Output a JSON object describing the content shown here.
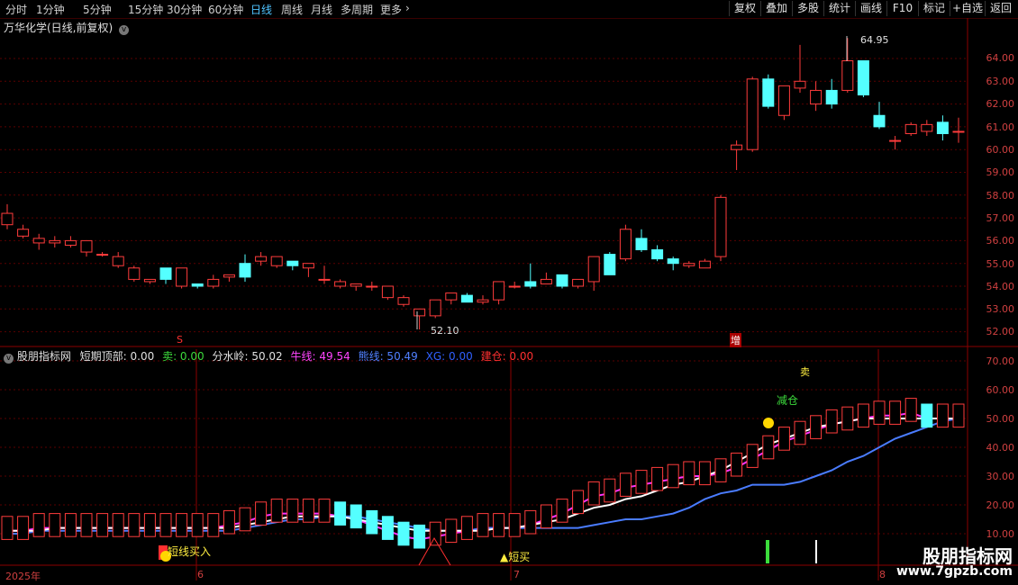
{
  "toolbar": {
    "periods": [
      "分时",
      "1分钟",
      "5分钟",
      "15分钟",
      "30分钟",
      "60分钟",
      "日线",
      "周线",
      "月线",
      "多周期",
      "更多"
    ],
    "active_period": "日线",
    "right_buttons": [
      "复权",
      "叠加",
      "多股",
      "统计",
      "画线",
      "F10",
      "标记",
      "+自选",
      "返回"
    ]
  },
  "main_panel": {
    "title": "万华化学(日线,前复权)",
    "y_ticks": [
      "64.00",
      "63.00",
      "62.00",
      "61.00",
      "60.00",
      "59.00",
      "58.00",
      "57.00",
      "56.00",
      "55.00",
      "54.00",
      "53.00",
      "52.00"
    ],
    "high_label": "64.95",
    "low_label": "52.10",
    "markers": [
      "S",
      "增"
    ]
  },
  "indicator_panel": {
    "name": "股朋指标网",
    "items": [
      {
        "label": "短期顶部: 0.00",
        "color": "#e0e0e0"
      },
      {
        "label": "卖: 0.00",
        "color": "#3cdc3c"
      },
      {
        "label": "分水岭: 50.02",
        "color": "#e0e0e0"
      },
      {
        "label": "牛线: 49.54",
        "color": "#ff44ff"
      },
      {
        "label": "熊线: 50.49",
        "color": "#5080ff"
      },
      {
        "label": "XG: 0.00",
        "color": "#3060ff"
      },
      {
        "label": "建仓: 0.00",
        "color": "#ff3030"
      }
    ],
    "y_ticks": [
      "70.00",
      "60.00",
      "50.00",
      "40.00",
      "30.00",
      "20.00",
      "10.00"
    ],
    "annotations": {
      "buy_short": "短线买入",
      "short_buy": "▲短买",
      "reduce": "减仓",
      "sell": "卖"
    }
  },
  "date_axis": {
    "labels": [
      "2025年",
      "6",
      "7",
      "8"
    ]
  },
  "watermark": {
    "title": "股朋指标网",
    "url": "www.7gpzb.com"
  },
  "colors": {
    "up": "#ff3c3c",
    "down": "#54ffff",
    "bull": "#ff33ff",
    "bear": "#4a7cff",
    "divide": "#ffffff",
    "grid": "#5a0000"
  },
  "chart_data": {
    "type": "candlestick",
    "series": [
      {
        "name": "price",
        "ohlc": [
          [
            56.7,
            57.6,
            56.5,
            57.2
          ],
          [
            56.2,
            56.7,
            56.1,
            56.5
          ],
          [
            55.9,
            56.3,
            55.6,
            56.1
          ],
          [
            55.9,
            56.2,
            55.7,
            56.0
          ],
          [
            55.8,
            56.2,
            55.7,
            56.0
          ],
          [
            55.5,
            56.0,
            55.3,
            56.0
          ],
          [
            55.4,
            55.5,
            55.3,
            55.4
          ],
          [
            54.9,
            55.5,
            54.8,
            55.3
          ],
          [
            54.3,
            54.9,
            54.2,
            54.8
          ],
          [
            54.2,
            54.3,
            54.1,
            54.3
          ],
          [
            54.8,
            54.8,
            54.1,
            54.3
          ],
          [
            54.0,
            54.8,
            53.9,
            54.8
          ],
          [
            54.1,
            54.1,
            53.9,
            54.0
          ],
          [
            54.0,
            54.5,
            53.9,
            54.3
          ],
          [
            54.4,
            54.5,
            54.2,
            54.5
          ],
          [
            55.0,
            55.4,
            54.2,
            54.4
          ],
          [
            55.1,
            55.5,
            54.9,
            55.3
          ],
          [
            54.9,
            55.3,
            54.8,
            55.3
          ],
          [
            55.1,
            55.1,
            54.7,
            54.9
          ],
          [
            54.8,
            55.0,
            54.4,
            55.0
          ],
          [
            54.3,
            54.9,
            54.1,
            54.3
          ],
          [
            54.0,
            54.3,
            53.9,
            54.2
          ],
          [
            54.0,
            54.1,
            53.8,
            54.1
          ],
          [
            54.0,
            54.2,
            53.8,
            54.0
          ],
          [
            53.5,
            54.0,
            53.4,
            54.0
          ],
          [
            53.2,
            53.6,
            53.1,
            53.5
          ],
          [
            52.7,
            53.0,
            52.1,
            53.0
          ],
          [
            52.7,
            53.4,
            52.6,
            53.4
          ],
          [
            53.4,
            53.7,
            53.2,
            53.7
          ],
          [
            53.6,
            53.7,
            53.3,
            53.3
          ],
          [
            53.3,
            53.6,
            53.2,
            53.4
          ],
          [
            53.4,
            54.2,
            53.2,
            54.2
          ],
          [
            54.0,
            54.2,
            53.9,
            54.0
          ],
          [
            54.2,
            55.0,
            53.9,
            54.0
          ],
          [
            54.1,
            54.6,
            54.1,
            54.3
          ],
          [
            54.5,
            54.5,
            53.9,
            54.0
          ],
          [
            54.0,
            54.1,
            53.9,
            54.3
          ],
          [
            54.2,
            55.3,
            53.8,
            55.3
          ],
          [
            55.4,
            55.5,
            54.7,
            54.5
          ],
          [
            55.2,
            56.7,
            55.1,
            56.5
          ],
          [
            56.1,
            56.5,
            55.5,
            55.6
          ],
          [
            55.6,
            55.8,
            55.1,
            55.2
          ],
          [
            55.2,
            55.3,
            54.7,
            55.0
          ],
          [
            54.9,
            55.1,
            54.8,
            55.0
          ],
          [
            54.8,
            55.2,
            54.8,
            55.1
          ],
          [
            55.3,
            58.0,
            55.1,
            57.9
          ],
          [
            60.0,
            60.4,
            59.1,
            60.2
          ],
          [
            60.0,
            63.2,
            59.9,
            63.1
          ],
          [
            63.1,
            63.3,
            61.8,
            61.9
          ],
          [
            61.5,
            62.8,
            61.3,
            62.8
          ],
          [
            62.7,
            64.6,
            62.5,
            63.0
          ],
          [
            62.0,
            63.0,
            61.7,
            62.6
          ],
          [
            62.6,
            63.1,
            61.8,
            62.0
          ],
          [
            62.6,
            64.9,
            62.5,
            63.9
          ],
          [
            63.9,
            63.9,
            62.3,
            62.4
          ],
          [
            61.5,
            62.1,
            60.9,
            61.0
          ],
          [
            60.4,
            60.6,
            60.0,
            60.4
          ],
          [
            60.7,
            61.2,
            60.6,
            61.1
          ],
          [
            60.8,
            61.3,
            60.6,
            61.1
          ],
          [
            61.2,
            61.5,
            60.4,
            60.7
          ],
          [
            60.8,
            61.4,
            60.3,
            60.8
          ]
        ]
      },
      {
        "name": "牛线",
        "values": [
          11,
          11,
          12,
          12,
          12,
          12,
          12,
          12,
          12,
          12,
          12,
          12,
          12,
          12,
          13,
          14,
          16,
          17,
          17,
          17,
          17,
          16,
          15,
          13,
          11,
          9,
          8,
          9,
          10,
          11,
          12,
          12,
          12,
          13,
          15,
          17,
          20,
          23,
          24,
          26,
          27,
          28,
          29,
          30,
          30,
          31,
          33,
          36,
          39,
          42,
          44,
          46,
          48,
          49,
          50,
          51,
          51,
          52,
          50,
          50,
          50
        ]
      },
      {
        "name": "熊线",
        "values": [
          10,
          10,
          11,
          11,
          11,
          11,
          11,
          11,
          11,
          11,
          11,
          11,
          11,
          11,
          11,
          12,
          13,
          14,
          15,
          15,
          16,
          16,
          16,
          15,
          14,
          13,
          12,
          11,
          11,
          11,
          12,
          12,
          12,
          12,
          12,
          12,
          12,
          13,
          14,
          15,
          15,
          16,
          17,
          19,
          22,
          24,
          25,
          27,
          27,
          27,
          28,
          30,
          32,
          35,
          37,
          40,
          43,
          45,
          47,
          49,
          50
        ]
      },
      {
        "name": "分水岭",
        "values": [
          11,
          11,
          11,
          12,
          12,
          12,
          12,
          12,
          12,
          12,
          12,
          12,
          12,
          12,
          12,
          13,
          14,
          15,
          16,
          16,
          16,
          16,
          15,
          14,
          13,
          12,
          11,
          11,
          11,
          11,
          11,
          12,
          12,
          13,
          14,
          15,
          17,
          19,
          20,
          22,
          23,
          25,
          27,
          28,
          30,
          32,
          35,
          38,
          41,
          43,
          45,
          47,
          48,
          49,
          50,
          50,
          50,
          50,
          50,
          50,
          50
        ]
      }
    ],
    "y_ticks": [
      64,
      63,
      62,
      61,
      60,
      59,
      58,
      57,
      56,
      55,
      54,
      53,
      52
    ]
  }
}
